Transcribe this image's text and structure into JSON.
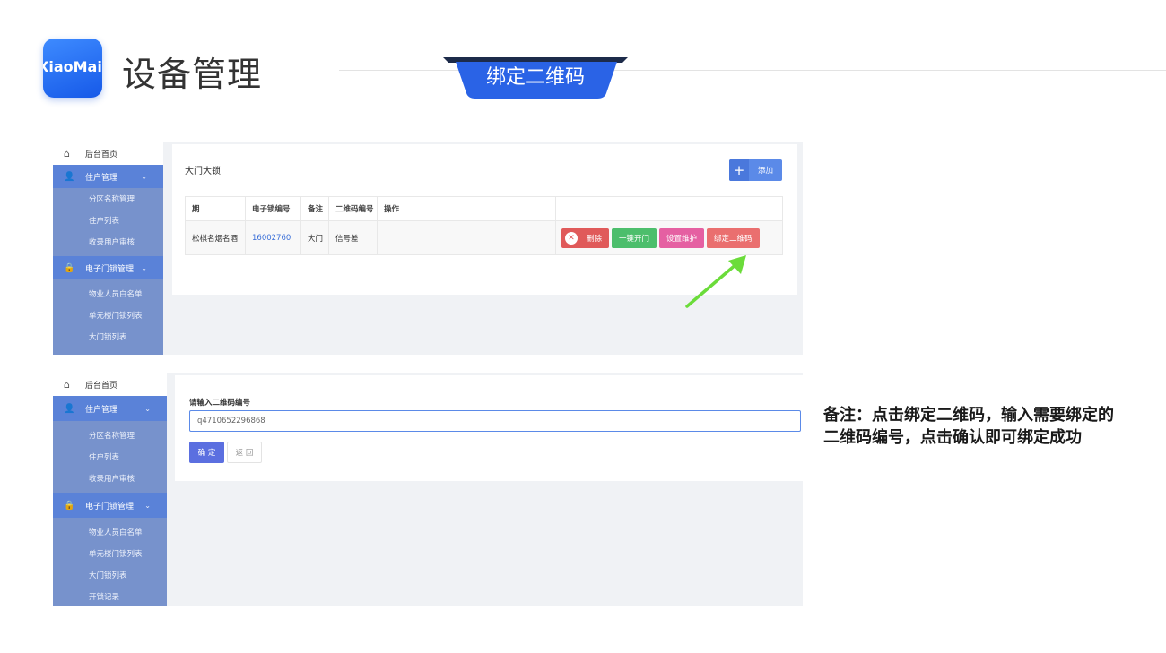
{
  "header": {
    "logo_text": "XiaoMai",
    "page_title": "设备管理",
    "section_tag": "绑定二维码"
  },
  "colors": {
    "brand_blue": "#2a6ef0",
    "sidebar_group": "#5a82d8",
    "sidebar_sub": "#7792cc",
    "delete_red": "#e05a5a",
    "open_green": "#4cbe6c",
    "maint_pink": "#e560a2",
    "bind_red": "#ea6f6f",
    "arrow_green": "#6bdc3a"
  },
  "sidebar1": {
    "home": "后台首页",
    "home_icon": "home-icon",
    "groups": [
      {
        "label": "住户管理",
        "icon": "user-icon",
        "items": [
          "分区名称管理",
          "住户列表",
          "收录用户审核"
        ]
      },
      {
        "label": "电子门锁管理",
        "icon": "lock-icon",
        "items": [
          "物业人员白名单",
          "单元楼门锁列表",
          "大门锁列表"
        ]
      }
    ]
  },
  "screen1": {
    "card_title": "大门大锁",
    "add_label": "添加",
    "table": {
      "headers": [
        "期",
        "电子锁编号",
        "备注",
        "二维码编号",
        "操作"
      ],
      "row": [
        "松棋名烟名酒",
        "16002760",
        "大门",
        "信号差",
        ""
      ]
    },
    "ops": {
      "delete": "删除",
      "open": "一键开门",
      "maintain": "设置维护",
      "bind": "绑定二维码"
    }
  },
  "sidebar2": {
    "home": "后台首页",
    "groups": [
      {
        "label": "住户管理",
        "items": [
          "分区名称管理",
          "住户列表",
          "收录用户审核"
        ]
      },
      {
        "label": "电子门锁管理",
        "items": [
          "物业人员白名单",
          "单元楼门锁列表",
          "大门锁列表",
          "开锁记录"
        ]
      }
    ]
  },
  "screen2": {
    "form_label": "请输入二维码编号",
    "input_value": "q4710652296868",
    "ok": "确 定",
    "back": "返 回"
  },
  "note": "备注：点击绑定二维码，输入需要绑定的二维码编号，点击确认即可绑定成功"
}
